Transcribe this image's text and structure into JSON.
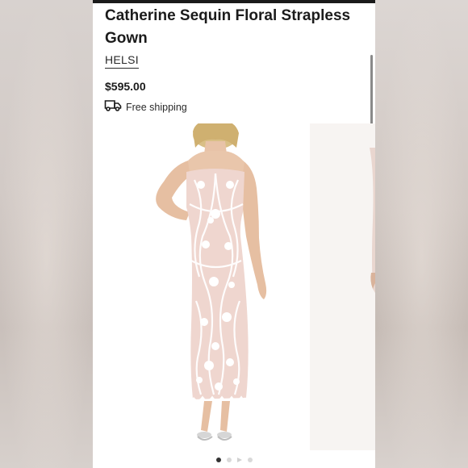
{
  "product": {
    "title": "Catherine Sequin Floral Strapless Gown",
    "brand": "HELSI",
    "price": "$595.00",
    "shipping_label": "Free shipping"
  },
  "icons": {
    "shipping": "truck-icon",
    "carousel_video": "play-icon"
  },
  "carousel": {
    "slide_count": 4,
    "active_index": 0
  },
  "colors": {
    "text": "#1b1b1b",
    "active_dot": "#333333",
    "inactive_dot": "#d9d9d9",
    "dress_base": "#efd6cf",
    "sequin": "#ffffff"
  }
}
